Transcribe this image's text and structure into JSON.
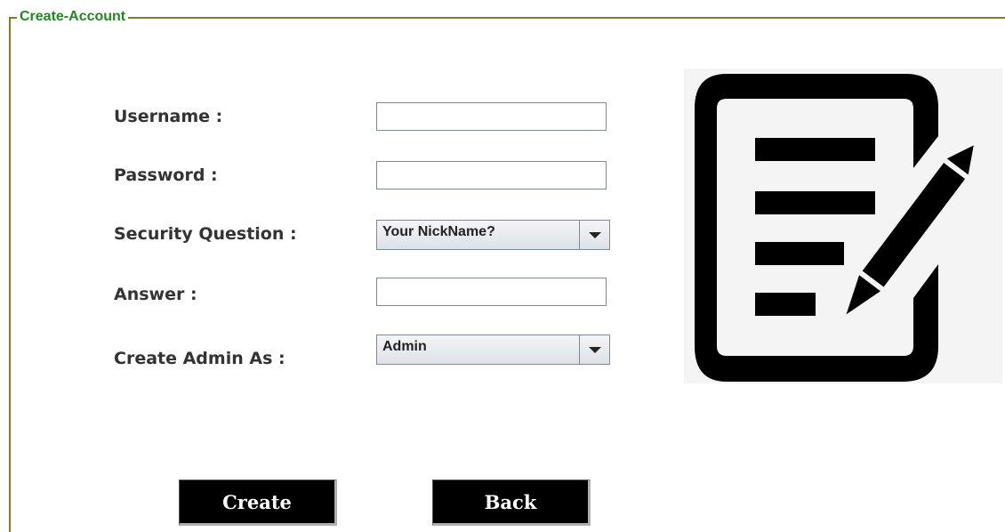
{
  "panel": {
    "title": "Create-Account"
  },
  "form": {
    "username_label": "Username :",
    "password_label": "Password :",
    "security_question_label": "Security Question :",
    "security_question_value": "Your NickName?",
    "answer_label": "Answer :",
    "create_admin_label": "Create Admin As :",
    "create_admin_value": "Admin",
    "username_value": "",
    "password_value": "",
    "answer_value": ""
  },
  "buttons": {
    "create": "Create",
    "back": "Back"
  },
  "icons": {
    "illustration": "edit-document-icon"
  },
  "colors": {
    "border": "#8a7a18",
    "title": "#1e8a1e",
    "button_bg": "#000000"
  }
}
